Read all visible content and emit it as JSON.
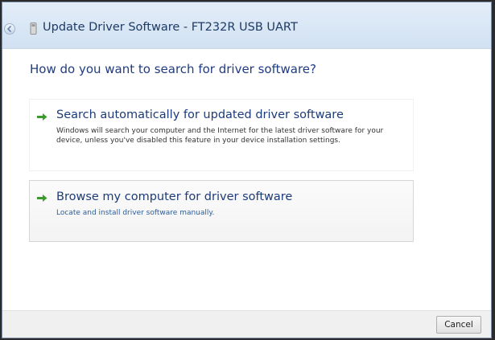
{
  "window": {
    "title": "Update Driver Software - FT232R USB UART"
  },
  "heading": "How do you want to search for driver software?",
  "options": [
    {
      "title": "Search automatically for updated driver software",
      "description": "Windows will search your computer and the Internet for the latest driver software for your device, unless you've disabled this feature in your device installation settings.",
      "icon": "green-arrow-icon"
    },
    {
      "title": "Browse my computer for driver software",
      "description": "Locate and install driver software manually.",
      "icon": "green-arrow-icon"
    }
  ],
  "footer": {
    "cancel_label": "Cancel"
  },
  "colors": {
    "accent_arrow": "#3a9a2e",
    "heading": "#1f3c82",
    "titlebar": "#d1e1f2"
  }
}
